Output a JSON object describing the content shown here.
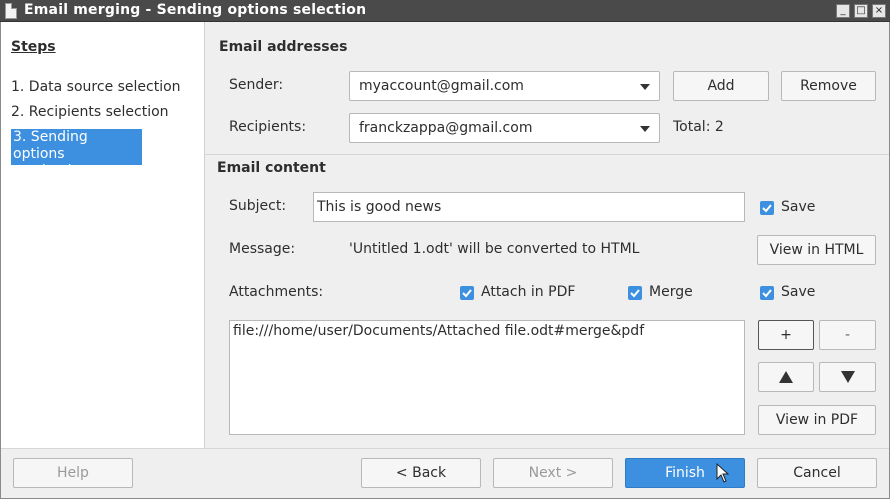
{
  "window": {
    "title": "Email merging - Sending options selection"
  },
  "sidebar": {
    "title": "Steps",
    "items": [
      {
        "label": "1. Data source selection"
      },
      {
        "label": "2. Recipients selection"
      },
      {
        "label": "3. Sending options",
        "label2": "selection"
      }
    ]
  },
  "email_addresses": {
    "title": "Email addresses",
    "sender_label": "Sender:",
    "sender_value": "myaccount@gmail.com",
    "add_label": "Add",
    "remove_label": "Remove",
    "recipients_label": "Recipients:",
    "recipients_value": "franckzappa@gmail.com",
    "total_label": "Total: 2"
  },
  "email_content": {
    "title": "Email content",
    "subject_label": "Subject:",
    "subject_value": "This is good news",
    "subject_save_label": "Save",
    "message_label": "Message:",
    "message_value": "'Untitled 1.odt' will be converted to HTML",
    "view_html_label": "View in HTML",
    "attachments_label": "Attachments:",
    "attach_pdf_label": "Attach in PDF",
    "merge_label": "Merge",
    "attach_save_label": "Save",
    "attachment_item": "file:///home/user/Documents/Attached file.odt#merge&pdf",
    "plus_label": "+",
    "minus_label": "-",
    "view_pdf_label": "View in PDF"
  },
  "footer": {
    "help_label": "Help",
    "back_label": "< Back",
    "next_label": "Next >",
    "finish_label": "Finish",
    "cancel_label": "Cancel"
  }
}
